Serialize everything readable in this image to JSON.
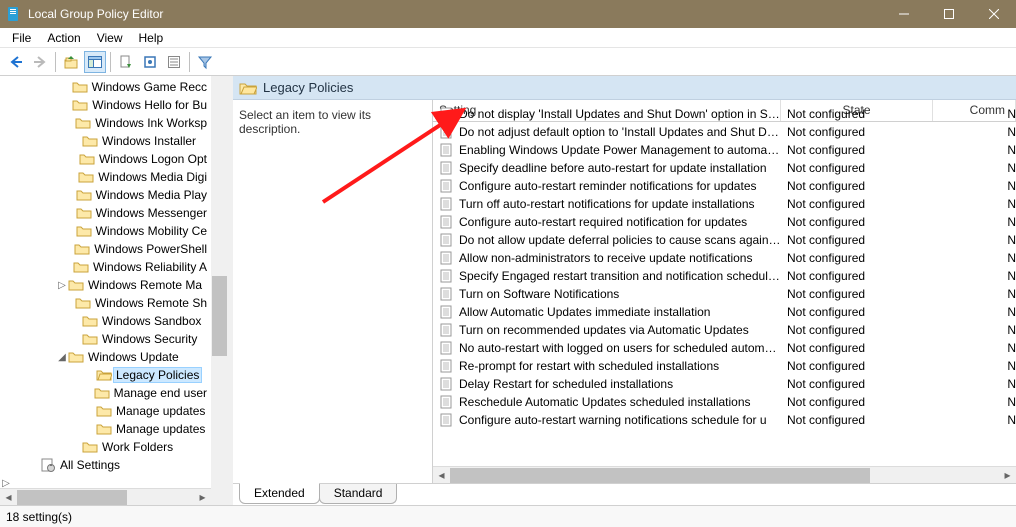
{
  "window": {
    "title": "Local Group Policy Editor"
  },
  "menu": [
    "File",
    "Action",
    "View",
    "Help"
  ],
  "tree": [
    {
      "ind": 5,
      "tw": "",
      "icon": "f",
      "label": "Windows Game Recc"
    },
    {
      "ind": 5,
      "tw": "",
      "icon": "f",
      "label": "Windows Hello for Bu"
    },
    {
      "ind": 5,
      "tw": "",
      "icon": "f",
      "label": "Windows Ink Worksp"
    },
    {
      "ind": 5,
      "tw": "",
      "icon": "f",
      "label": "Windows Installer"
    },
    {
      "ind": 5,
      "tw": "",
      "icon": "f",
      "label": "Windows Logon Opt"
    },
    {
      "ind": 5,
      "tw": "",
      "icon": "f",
      "label": "Windows Media Digi"
    },
    {
      "ind": 5,
      "tw": "",
      "icon": "f",
      "label": "Windows Media Play"
    },
    {
      "ind": 5,
      "tw": "",
      "icon": "f",
      "label": "Windows Messenger"
    },
    {
      "ind": 5,
      "tw": "",
      "icon": "f",
      "label": "Windows Mobility Ce"
    },
    {
      "ind": 5,
      "tw": "",
      "icon": "f",
      "label": "Windows PowerShell"
    },
    {
      "ind": 5,
      "tw": "",
      "icon": "f",
      "label": "Windows Reliability A"
    },
    {
      "ind": 4,
      "tw": ">",
      "icon": "f",
      "label": "Windows Remote Ma"
    },
    {
      "ind": 5,
      "tw": "",
      "icon": "f",
      "label": "Windows Remote Sh"
    },
    {
      "ind": 5,
      "tw": "",
      "icon": "f",
      "label": "Windows Sandbox"
    },
    {
      "ind": 5,
      "tw": "",
      "icon": "f",
      "label": "Windows Security"
    },
    {
      "ind": 4,
      "tw": "v",
      "icon": "f",
      "label": "Windows Update"
    },
    {
      "ind": 6,
      "tw": "",
      "icon": "fo",
      "label": "Legacy Policies",
      "sel": true
    },
    {
      "ind": 6,
      "tw": "",
      "icon": "f",
      "label": "Manage end user"
    },
    {
      "ind": 6,
      "tw": "",
      "icon": "f",
      "label": "Manage updates"
    },
    {
      "ind": 6,
      "tw": "",
      "icon": "f",
      "label": "Manage updates"
    },
    {
      "ind": 5,
      "tw": "",
      "icon": "f",
      "label": "Work Folders"
    },
    {
      "ind": 2,
      "tw": "",
      "icon": "s",
      "label": "All Settings"
    },
    {
      "ind": 0,
      "tw": ">",
      "icon": "",
      "label": ""
    }
  ],
  "right": {
    "title": "Legacy Policies",
    "description": "Select an item to view its description.",
    "columns": {
      "setting": "Setting",
      "state": "State",
      "comment": "Comm"
    },
    "rows": [
      {
        "s": "Do not display 'Install Updates and Shut Down' option in Sh...",
        "st": "Not configured",
        "c": "N"
      },
      {
        "s": "Do not adjust default option to 'Install Updates and Shut Do...",
        "st": "Not configured",
        "c": "N"
      },
      {
        "s": "Enabling Windows Update Power Management to automati...",
        "st": "Not configured",
        "c": "N"
      },
      {
        "s": "Specify deadline before auto-restart for update installation",
        "st": "Not configured",
        "c": "N"
      },
      {
        "s": "Configure auto-restart reminder notifications for updates",
        "st": "Not configured",
        "c": "N"
      },
      {
        "s": "Turn off auto-restart notifications for update installations",
        "st": "Not configured",
        "c": "N"
      },
      {
        "s": "Configure auto-restart required notification for updates",
        "st": "Not configured",
        "c": "N"
      },
      {
        "s": "Do not allow update deferral policies to cause scans against ...",
        "st": "Not configured",
        "c": "N"
      },
      {
        "s": "Allow non-administrators to receive update notifications",
        "st": "Not configured",
        "c": "N"
      },
      {
        "s": "Specify Engaged restart transition and notification schedule ...",
        "st": "Not configured",
        "c": "N"
      },
      {
        "s": "Turn on Software Notifications",
        "st": "Not configured",
        "c": "N"
      },
      {
        "s": "Allow Automatic Updates immediate installation",
        "st": "Not configured",
        "c": "N"
      },
      {
        "s": "Turn on recommended updates via Automatic Updates",
        "st": "Not configured",
        "c": "N"
      },
      {
        "s": "No auto-restart with logged on users for scheduled automat...",
        "st": "Not configured",
        "c": "N"
      },
      {
        "s": "Re-prompt for restart with scheduled installations",
        "st": "Not configured",
        "c": "N"
      },
      {
        "s": "Delay Restart for scheduled installations",
        "st": "Not configured",
        "c": "N"
      },
      {
        "s": "Reschedule Automatic Updates scheduled installations",
        "st": "Not configured",
        "c": "N"
      },
      {
        "s": "Configure auto-restart warning notifications schedule for u",
        "st": "Not configured",
        "c": "N"
      }
    ]
  },
  "tabs": {
    "extended": "Extended",
    "standard": "Standard"
  },
  "status": "18 setting(s)"
}
